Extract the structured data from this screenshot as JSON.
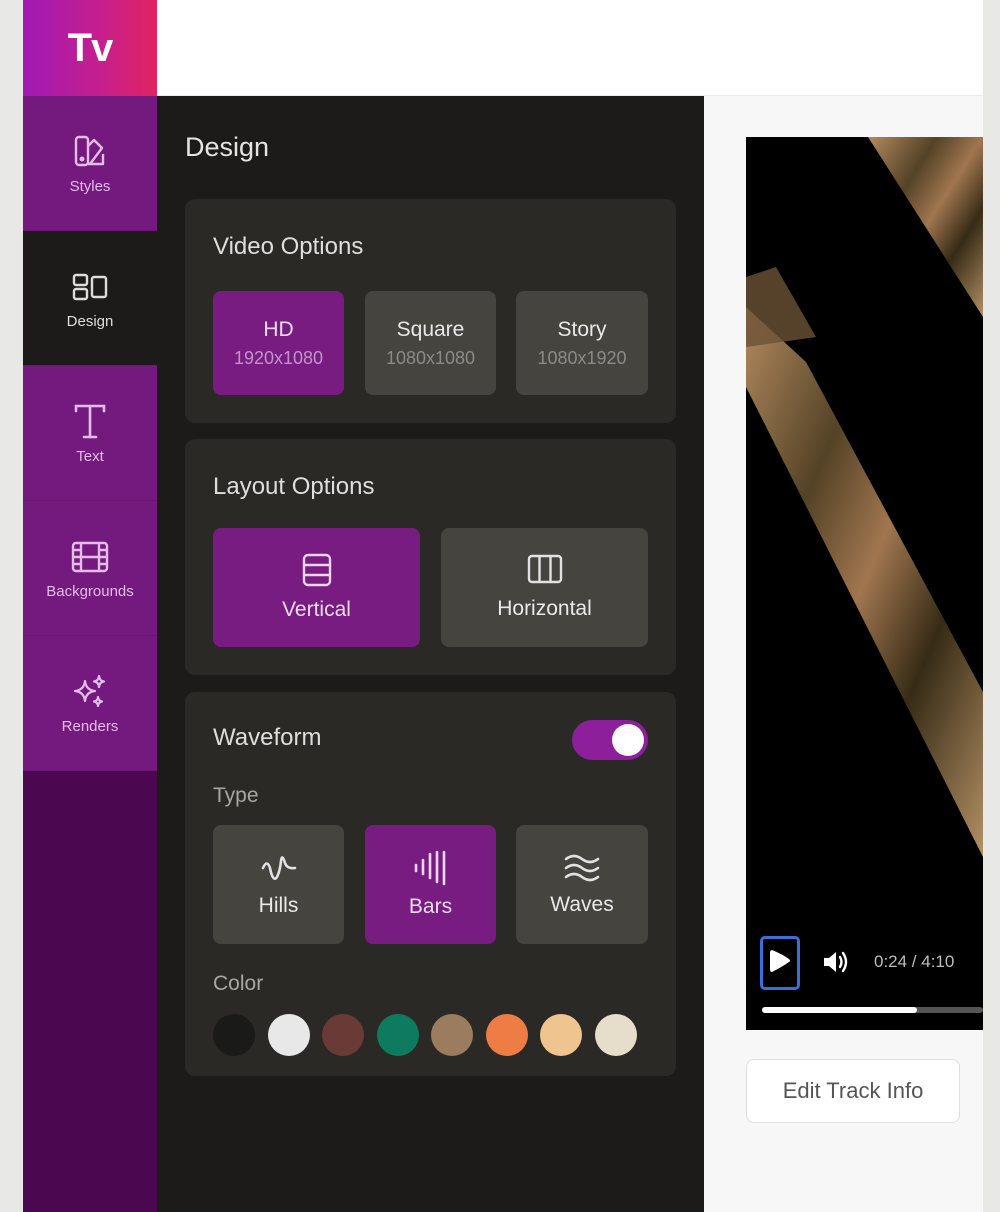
{
  "app": {
    "logo": "Tv"
  },
  "rail": {
    "items": [
      {
        "label": "Styles",
        "icon": "palette-swatch-icon",
        "active": false
      },
      {
        "label": "Design",
        "icon": "layout-grid-icon",
        "active": true
      },
      {
        "label": "Text",
        "icon": "text-t-icon",
        "active": false
      },
      {
        "label": "Backgrounds",
        "icon": "film-strip-icon",
        "active": false
      },
      {
        "label": "Renders",
        "icon": "sparkles-icon",
        "active": false
      }
    ]
  },
  "panel": {
    "title": "Design",
    "video_options": {
      "title": "Video Options",
      "options": [
        {
          "name": "HD",
          "resolution": "1920x1080",
          "selected": true
        },
        {
          "name": "Square",
          "resolution": "1080x1080",
          "selected": false
        },
        {
          "name": "Story",
          "resolution": "1080x1920",
          "selected": false
        }
      ]
    },
    "layout_options": {
      "title": "Layout Options",
      "options": [
        {
          "name": "Vertical",
          "icon": "rows-icon",
          "selected": true
        },
        {
          "name": "Horizontal",
          "icon": "columns-icon",
          "selected": false
        }
      ]
    },
    "waveform": {
      "title": "Waveform",
      "enabled": true,
      "type_label": "Type",
      "types": [
        {
          "name": "Hills",
          "icon": "hills-wave-icon",
          "selected": false
        },
        {
          "name": "Bars",
          "icon": "audio-bars-icon",
          "selected": true
        },
        {
          "name": "Waves",
          "icon": "waves-icon",
          "selected": false
        }
      ],
      "color_label": "Color",
      "colors": [
        "#1a1a18",
        "#e8e8e8",
        "#6a3a36",
        "#0e7a5e",
        "#9c7c5f",
        "#ee7c45",
        "#efc48e",
        "#e6ddcb"
      ]
    }
  },
  "preview": {
    "time": "0:24 / 4:10",
    "progress": 0.7,
    "play_icon": "play-icon",
    "volume_icon": "volume-icon"
  },
  "edit_track_label": "Edit Track Info",
  "colors": {
    "accent": "#781c82",
    "rail": "#741a7e",
    "rail_dark": "#4b0850",
    "panel": "#1c1b19",
    "card": "#2a2925"
  }
}
